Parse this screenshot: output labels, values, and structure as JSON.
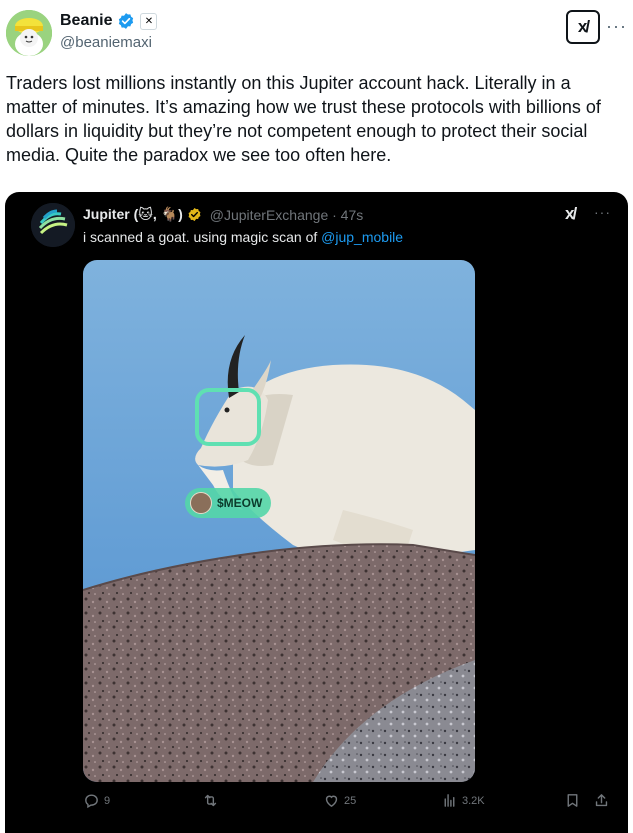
{
  "post": {
    "author": {
      "name": "Beanie",
      "handle": "@beaniemaxi",
      "affiliation_badge": "✕"
    },
    "grok_label": "x/",
    "more_label": "···",
    "text": "Traders lost millions instantly on this Jupiter account hack. Literally in a matter of minutes. It’s amazing how we trust these protocols with billions of dollars in liquidity but they’re not competent enough to protect their social media. Quite the paradox we see too often here."
  },
  "quoted": {
    "author": {
      "name": "Jupiter (",
      "name_suffix": ", ",
      "name_end": ")",
      "handle_time": "@JupiterExchange · 47s"
    },
    "text_before": "i scanned a  goat. using magic scan of ",
    "text_link": "@jup_mobile",
    "grok_label": "x/",
    "more_label": "···",
    "media": {
      "token_label": "$MEOW"
    },
    "actions": {
      "replies": "9",
      "likes": "25",
      "views": "3.2K"
    }
  },
  "colors": {
    "accent_blue": "#1d9bf0",
    "scan_green": "#5fe0b2",
    "quote_bg": "#000000"
  },
  "icons": [
    "verified-badge-icon",
    "grok-icon",
    "more-icon",
    "reply-icon",
    "retweet-icon",
    "like-icon",
    "views-icon",
    "bookmark-icon",
    "share-icon",
    "cat-emoji-icon",
    "goat-emoji-icon"
  ]
}
